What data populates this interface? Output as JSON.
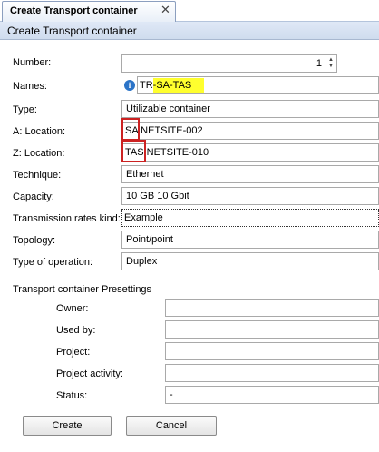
{
  "tab": {
    "title": "Create Transport container",
    "close_glyph": "✕"
  },
  "header": {
    "title": "Create Transport container"
  },
  "form": {
    "number": {
      "label": "Number:",
      "value": "1",
      "spin_up": "▲",
      "spin_down": "▼"
    },
    "names": {
      "label": "Names:",
      "info_glyph": "i",
      "value_prefix": "TR",
      "value_highlight": "-SA-TAS"
    },
    "type": {
      "label": "Type:",
      "value": "Utilizable container"
    },
    "a_location": {
      "label": "A: Location:",
      "value_boxed": "SA",
      "value_rest": " NETSITE-002"
    },
    "z_location": {
      "label": "Z: Location:",
      "value_boxed": "TAS",
      "value_rest": " NETSITE-010"
    },
    "technique": {
      "label": "Technique:",
      "value": "Ethernet"
    },
    "capacity": {
      "label": "Capacity:",
      "value": "10 GB 10 Gbit"
    },
    "transmission_rates_kind": {
      "label": "Transmission rates kind:",
      "value": "Example"
    },
    "topology": {
      "label": "Topology:",
      "value": "Point/point"
    },
    "type_of_operation": {
      "label": "Type of operation:",
      "value": "Duplex"
    }
  },
  "presettings": {
    "title": "Transport container Presettings",
    "owner": {
      "label": "Owner:",
      "value": ""
    },
    "used_by": {
      "label": "Used by:",
      "value": ""
    },
    "project": {
      "label": "Project:",
      "value": ""
    },
    "project_activity": {
      "label": "Project activity:",
      "value": ""
    },
    "status": {
      "label": "Status:",
      "value": "-"
    }
  },
  "buttons": {
    "create": "Create",
    "cancel": "Cancel"
  },
  "colors": {
    "highlight": "#ffff2e",
    "annotation_box": "#cc2222",
    "info_icon": "#2b74c8"
  }
}
